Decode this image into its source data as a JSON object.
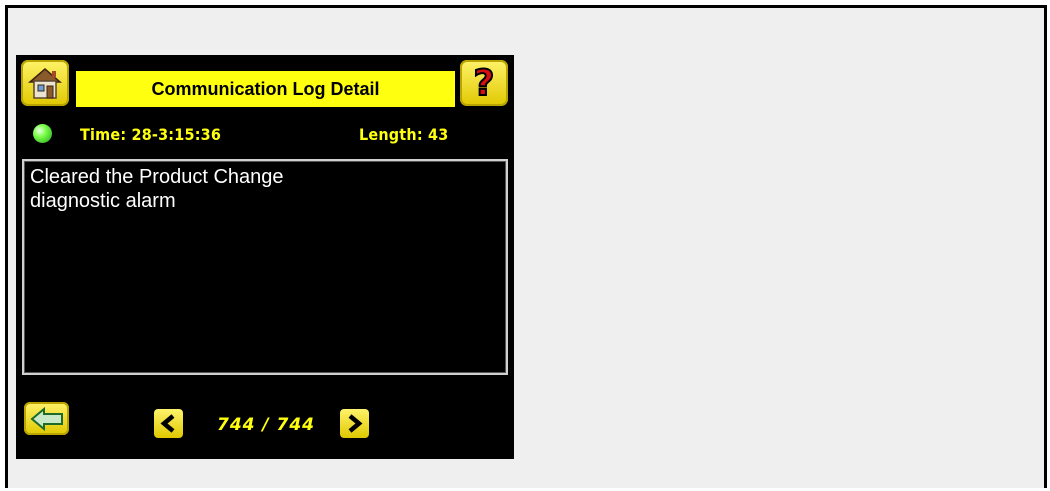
{
  "header": {
    "title": "Communication Log Detail",
    "home_icon": "home-icon",
    "help_icon": "help-icon"
  },
  "info": {
    "time": "Time: 28-3:15:36",
    "length": "Length: 43",
    "status_color": "#39e026"
  },
  "message": {
    "text": "Cleared the Product Change\ndiagnostic alarm"
  },
  "footer": {
    "page_counter": "744 / 744",
    "back_icon": "back-arrow-icon",
    "prev_icon": "chevron-left-icon",
    "next_icon": "chevron-right-icon"
  },
  "colors": {
    "accent_yellow": "#ffff10",
    "background": "#000000",
    "outer": "#efefef"
  }
}
